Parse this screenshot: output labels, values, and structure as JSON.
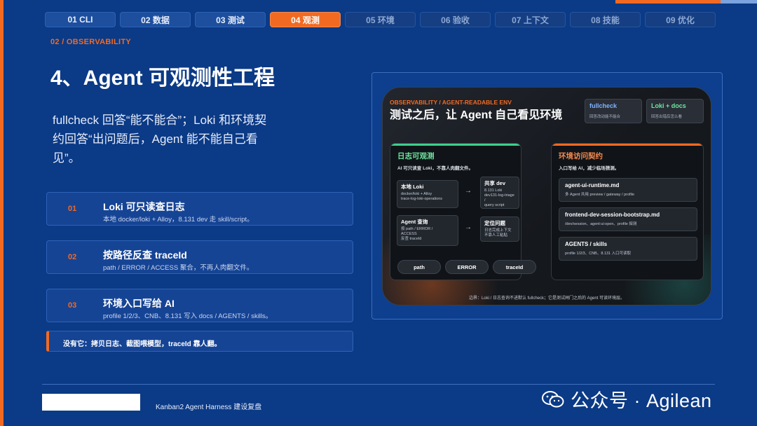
{
  "tabs": [
    {
      "label": "01 CLI",
      "state": "done"
    },
    {
      "label": "02 数据",
      "state": "done"
    },
    {
      "label": "03 测试",
      "state": "done"
    },
    {
      "label": "04 观测",
      "state": "active"
    },
    {
      "label": "05 环境",
      "state": "upcoming"
    },
    {
      "label": "06 验收",
      "state": "upcoming"
    },
    {
      "label": "07 上下文",
      "state": "upcoming"
    },
    {
      "label": "08 技能",
      "state": "upcoming"
    },
    {
      "label": "09 优化",
      "state": "upcoming"
    }
  ],
  "section_label": "02 / OBSERVABILITY",
  "title": "4、Agent 可观测性工程",
  "subtitle": "fullcheck 回答“能不能合”；Loki 和环境契约回答“出问题后，Agent 能不能自己看见”。",
  "cards": [
    {
      "num": "01",
      "title": "Loki 可只读查日志",
      "sub": "本地 docker/loki + Alloy，8.131 dev 走 skill/script。"
    },
    {
      "num": "02",
      "title": "按路径反查 traceId",
      "sub": "path / ERROR / ACCESS 聚合，不再人肉翻文件。"
    },
    {
      "num": "03",
      "title": "环境入口写给 AI",
      "sub": "profile 1/2/3、CNB、8.131 写入 docs / AGENTS / skills。"
    }
  ],
  "note": "没有它：拷贝日志、截图喂模型，traceId 靠人翻。",
  "panel": {
    "label": "OBSERVABILITY / AGENT-READABLE ENV",
    "title": "测试之后，让 Agent 自己看见环境",
    "pills": [
      {
        "title": "fullcheck",
        "sub": "回答改动能不能合"
      },
      {
        "title": "Loki + docs",
        "sub": "回答出错后怎么看"
      }
    ],
    "logs": {
      "heading": "日志可观测",
      "sub": "AI 可只读查 Loki，不靠人肉翻文件。",
      "boxes": [
        {
          "title": "本地 Loki",
          "sub": [
            "docker/loki + Alloy",
            "trace-log-loki-operations"
          ]
        },
        {
          "title": "共享 dev",
          "sub": [
            "8.131 Loki",
            "dev131-log-triage /",
            "query script"
          ]
        },
        {
          "title": "Agent 查询",
          "sub": [
            "按 path / ERROR /",
            "ACCESS",
            "反查 traceId"
          ]
        },
        {
          "title": "定位问题",
          "sub": [
            "日志完成上下文",
            "不靠人工粘贴"
          ]
        }
      ],
      "arrow": "→",
      "tags": [
        "path",
        "ERROR",
        "traceId"
      ]
    },
    "env": {
      "heading": "环境访问契约",
      "sub": "入口写给 AI，减少临场猜测。",
      "boxes": [
        {
          "title": "agent-ui-runtime.md",
          "sub": "多 Agent 共用 preview / gateway / profile"
        },
        {
          "title": "frontend-dev-session-bootstrap.md",
          "sub": "/dev/session、agent:ui:open、profile 探测"
        },
        {
          "title": "AGENTS / skills",
          "sub": "profile 1/2/3、CNB、8.131 入口可读取"
        }
      ]
    },
    "footnote": "边界：Loki / 日志查询不进默认 fullcheck；它是测试闸门之后的 Agent 可读环境层。"
  },
  "footer": {
    "text": "Kanban2 Agent Harness 建设复盘"
  },
  "watermark": {
    "text": "公众号 · Agilean"
  },
  "colors": {
    "accent": "#f26a22",
    "background": "#0b3a86",
    "logs_accent": "#3fcf8e",
    "fullcheck_text": "#7fb2ff",
    "docs_text": "#6ee7a0"
  }
}
